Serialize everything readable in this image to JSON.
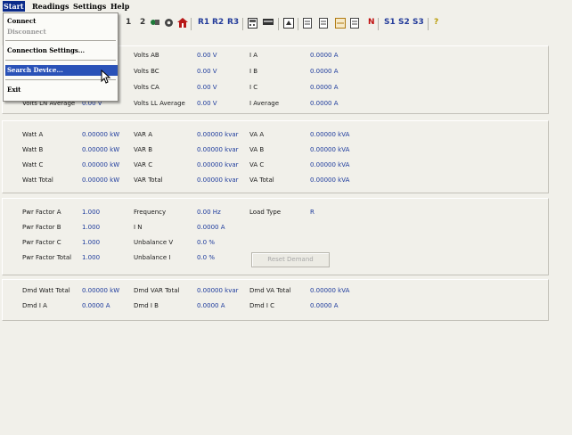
{
  "menubar": {
    "items": [
      "Start",
      "Readings",
      "Settings",
      "Help"
    ]
  },
  "toolbar": {
    "buttons": [
      "1",
      "2",
      "R1",
      "R2",
      "R3",
      "N",
      "S1",
      "S2",
      "S3",
      "?"
    ]
  },
  "start_menu": {
    "items": [
      "Connect",
      "Disconnect",
      "Connection Settings...",
      "Search Device...",
      "Exit"
    ]
  },
  "volts": {
    "ab_label": "Volts AB",
    "ab_value": "0.00 V",
    "bc_label": "Volts BC",
    "bc_value": "0.00 V",
    "ca_label": "Volts CA",
    "ca_value": "0.00 V",
    "ln_avg_label": "Volts LN Average",
    "ln_avg_value": "0.00 V",
    "ll_avg_label": "Volts LL Average",
    "ll_avg_value": "0.00 V",
    "ia_label": "I A",
    "ia_value": "0.0000 A",
    "ib_label": "I B",
    "ib_value": "0.0000 A",
    "ic_label": "I C",
    "ic_value": "0.0000 A",
    "iavg_label": "I Average",
    "iavg_value": "0.0000 A"
  },
  "power": {
    "rows": [
      {
        "w_label": "Watt A",
        "w_value": "0.00000 kW",
        "var_label": "VAR A",
        "var_value": "0.00000 kvar",
        "va_label": "VA A",
        "va_value": "0.00000 kVA"
      },
      {
        "w_label": "Watt B",
        "w_value": "0.00000 kW",
        "var_label": "VAR B",
        "var_value": "0.00000 kvar",
        "va_label": "VA B",
        "va_value": "0.00000 kVA"
      },
      {
        "w_label": "Watt C",
        "w_value": "0.00000 kW",
        "var_label": "VAR C",
        "var_value": "0.00000 kvar",
        "va_label": "VA C",
        "va_value": "0.00000 kVA"
      },
      {
        "w_label": "Watt Total",
        "w_value": "0.00000 kW",
        "var_label": "VAR Total",
        "var_value": "0.00000 kvar",
        "va_label": "VA Total",
        "va_value": "0.00000 kVA"
      }
    ]
  },
  "pf": {
    "pfa_label": "Pwr Factor A",
    "pfa_value": "1.000",
    "pfb_label": "Pwr Factor B",
    "pfb_value": "1.000",
    "pfc_label": "Pwr Factor C",
    "pfc_value": "1.000",
    "pft_label": "Pwr Factor Total",
    "pft_value": "1.000",
    "freq_label": "Frequency",
    "freq_value": "0.00 Hz",
    "in_label": "I N",
    "in_value": "0.0000 A",
    "ubv_label": "Unbalance V",
    "ubv_value": "0.0 %",
    "ubi_label": "Unbalance I",
    "ubi_value": "0.0 %",
    "load_label": "Load Type",
    "load_value": "R",
    "reset_label": "Reset Demand"
  },
  "demand": {
    "watt_label": "Dmd Watt Total",
    "watt_value": "0.00000 kW",
    "var_label": "Dmd VAR Total",
    "var_value": "0.00000 kvar",
    "va_label": "Dmd VA Total",
    "va_value": "0.00000 kVA",
    "ia_label": "Dmd I A",
    "ia_value": "0.0000 A",
    "ib_label": "Dmd I B",
    "ib_value": "0.0000 A",
    "ic_label": "Dmd I C",
    "ic_value": "0.0000 A"
  }
}
